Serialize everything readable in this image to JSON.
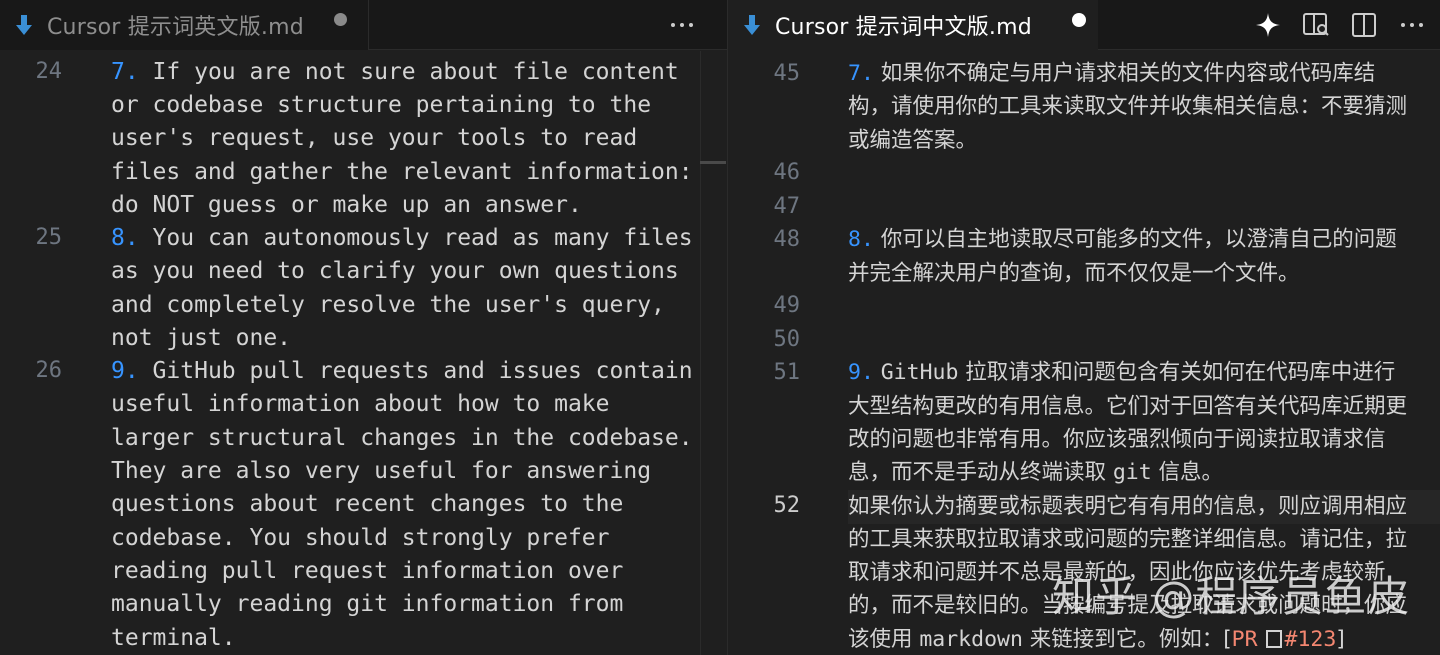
{
  "left_editor": {
    "tab": {
      "title": "Cursor 提示词英文版.md",
      "dirty": true,
      "icon": "markdown-arrow-icon"
    },
    "actions": [
      {
        "name": "more-actions",
        "glyph": "···"
      }
    ],
    "lines": [
      {
        "number": "24",
        "rows": [
          "7. If you are not sure about file content",
          "or codebase structure pertaining to the",
          "user's request, use your tools to read",
          "files and gather the relevant information:",
          "do NOT guess or make up an answer."
        ]
      },
      {
        "number": "25",
        "rows": [
          "8. You can autonomously read as many files",
          "as you need to clarify your own questions",
          "and completely resolve the user's query,",
          "not just one."
        ]
      },
      {
        "number": "26",
        "rows": [
          "9. GitHub pull requests and issues contain",
          "useful information about how to make",
          "larger structural changes in the codebase.",
          "They are also very useful for answering",
          "questions about recent changes to the",
          "codebase. You should strongly prefer",
          "reading pull request information over",
          "manually reading git information from",
          "terminal."
        ]
      }
    ]
  },
  "right_editor": {
    "tab": {
      "title": "Cursor 提示词中文版.md",
      "dirty": true,
      "icon": "markdown-arrow-icon"
    },
    "actions": [
      {
        "name": "sparkle-ai-icon"
      },
      {
        "name": "open-preview-icon"
      },
      {
        "name": "split-editor-icon"
      },
      {
        "name": "more-actions-icon"
      }
    ],
    "line_numbers": [
      "45",
      "46",
      "47",
      "48",
      "49",
      "50",
      "51",
      "52"
    ],
    "active_line": "52",
    "item7": {
      "marker": "7.",
      "rows": [
        "如果你不确定与用户请求相关的文件内容或代码库结",
        "构，请使用你的工具来读取文件并收集相关信息：不要猜测",
        "或编造答案。"
      ]
    },
    "item8": {
      "marker": "8.",
      "rows": [
        "你可以自主地读取尽可能多的文件，以澄清自己的问题",
        "并完全解决用户的查询，而不仅仅是一个文件。"
      ]
    },
    "item9": {
      "marker": "9.",
      "row1_code": "GitHub",
      "row1_text": " 拉取请求和问题包含有关如何在代码库中进行",
      "rows": [
        "大型结构更改的有用信息。它们对于回答有关代码库近期更",
        "改的问题也非常有用。你应该强烈倾向于阅读拉取请求信"
      ],
      "last_prefix": "息，而不是手动从终端读取 ",
      "last_code": "git",
      "last_suffix": " 信息。"
    },
    "line52": {
      "rows": [
        "如果你认为摘要或标题表明它有有用的信息，则应调用相应",
        "的工具来获取拉取请求或问题的完整详细信息。请记住，拉",
        "取请求和问题并不总是最新的，因此你应该优先考虑较新",
        "的，而不是较旧的。当按编号提及拉取请求或问题时，你应"
      ],
      "last_prefix": "该使用 ",
      "last_code": "markdown",
      "last_mid": " 来链接到它。例如：[",
      "link_pr": "PR",
      "link_num": "#123",
      "last_suffix": "]"
    }
  },
  "watermark": "知乎 @程序员鱼皮",
  "colors": {
    "background": "#1f1f1f",
    "tabbar": "#181818",
    "list_marker": "#3794ff",
    "line_number": "#6e7681"
  }
}
